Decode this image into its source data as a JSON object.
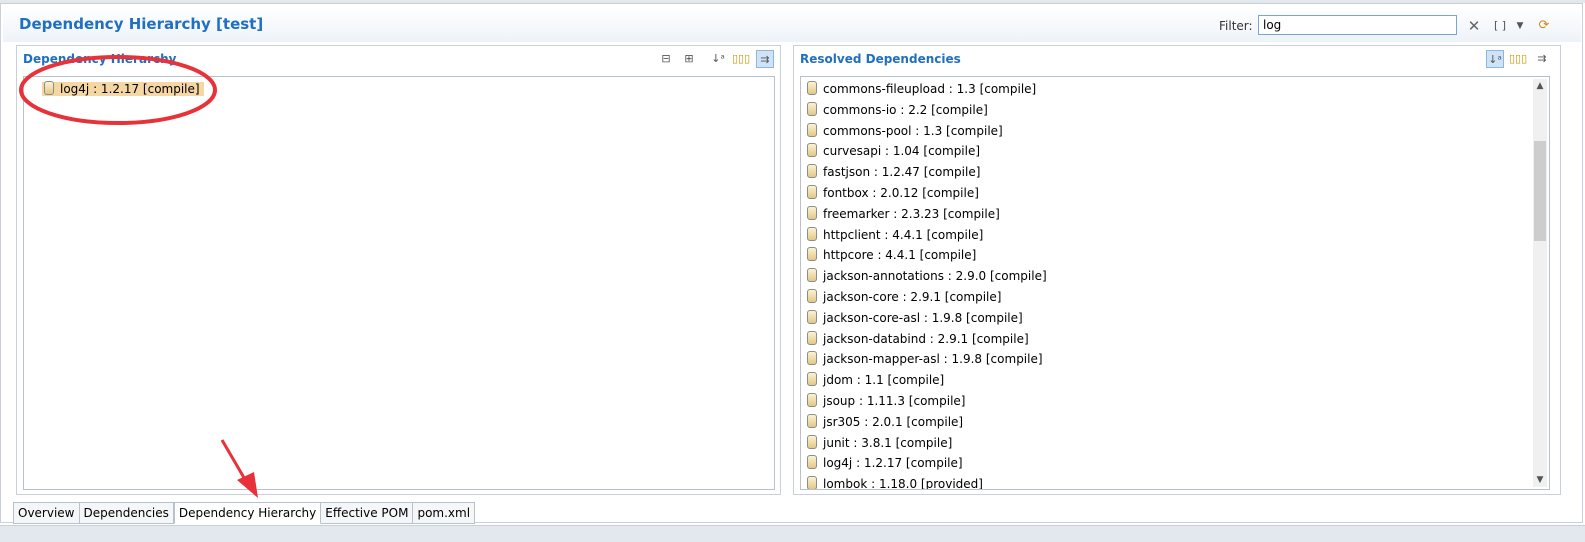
{
  "header": {
    "title": "Dependency Hierarchy [test]",
    "filter_label": "Filter:",
    "filter_value": "log"
  },
  "hierarchy": {
    "title": "Dependency Hierarchy",
    "items": [
      {
        "label": "log4j : 1.2.17 [compile]"
      }
    ]
  },
  "resolved": {
    "title": "Resolved Dependencies",
    "items": [
      {
        "label": "commons-fileupload : 1.3 [compile]"
      },
      {
        "label": "commons-io : 2.2 [compile]"
      },
      {
        "label": "commons-pool : 1.3 [compile]"
      },
      {
        "label": "curvesapi : 1.04 [compile]"
      },
      {
        "label": "fastjson : 1.2.47 [compile]"
      },
      {
        "label": "fontbox : 2.0.12 [compile]"
      },
      {
        "label": "freemarker : 2.3.23 [compile]"
      },
      {
        "label": "httpclient : 4.4.1 [compile]"
      },
      {
        "label": "httpcore : 4.4.1 [compile]"
      },
      {
        "label": "jackson-annotations : 2.9.0 [compile]"
      },
      {
        "label": "jackson-core : 2.9.1 [compile]"
      },
      {
        "label": "jackson-core-asl : 1.9.8 [compile]"
      },
      {
        "label": "jackson-databind : 2.9.1 [compile]"
      },
      {
        "label": "jackson-mapper-asl : 1.9.8 [compile]"
      },
      {
        "label": "jdom : 1.1 [compile]"
      },
      {
        "label": "jsoup : 1.11.3 [compile]"
      },
      {
        "label": "jsr305 : 2.0.1 [compile]"
      },
      {
        "label": "junit : 3.8.1 [compile]"
      },
      {
        "label": "log4j : 1.2.17 [compile]"
      },
      {
        "label": "lombok : 1.18.0 [provided]"
      }
    ]
  },
  "tabs": [
    {
      "label": "Overview"
    },
    {
      "label": "Dependencies"
    },
    {
      "label": "Dependency Hierarchy"
    },
    {
      "label": "Effective POM"
    },
    {
      "label": "pom.xml"
    }
  ],
  "active_tab": "Dependency Hierarchy",
  "colors": {
    "title_blue": "#1f6fc3",
    "selection": "#f5d7a3",
    "annotation_red": "#e8323a"
  },
  "icons": [
    "collapse-all-icon",
    "expand-all-icon",
    "sort-icon",
    "show-groupid-icon",
    "link-with-editor-icon",
    "clear-filter-icon",
    "filter-mode-icon",
    "dropdown-icon",
    "refresh-icon",
    "jar-icon"
  ]
}
